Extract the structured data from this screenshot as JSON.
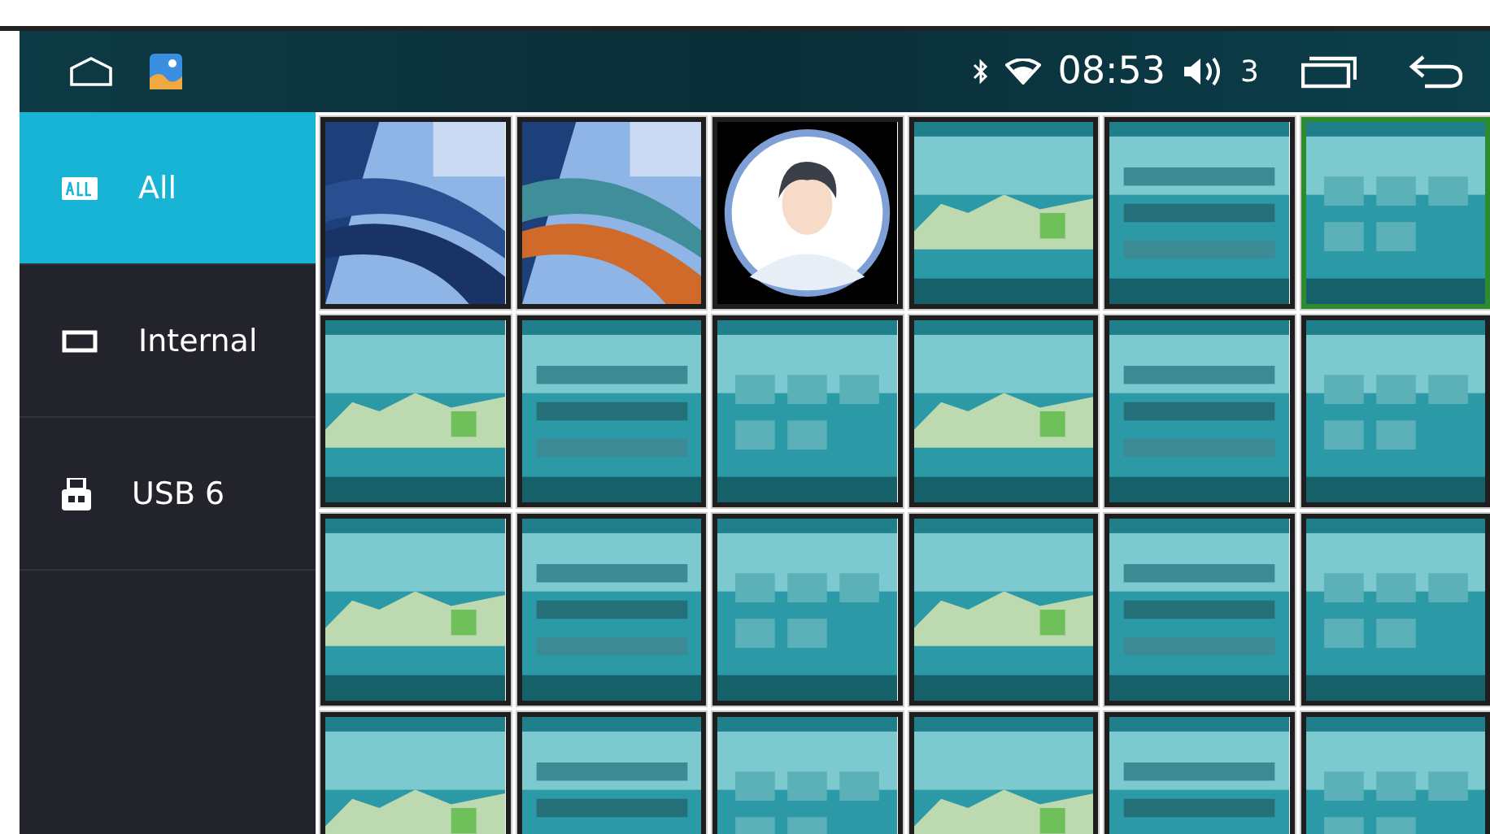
{
  "status_bar": {
    "time": "08:53",
    "volume": "3"
  },
  "sidebar": {
    "items": [
      {
        "label": "All",
        "kind": "all",
        "selected": true
      },
      {
        "label": "Internal",
        "kind": "internal",
        "selected": false
      },
      {
        "label": "USB 6",
        "kind": "usb",
        "selected": false
      }
    ]
  },
  "thumbnails": [
    {
      "kind": "picture",
      "selected": false
    },
    {
      "kind": "picture",
      "selected": false
    },
    {
      "kind": "picture",
      "selected": false
    },
    {
      "kind": "picture",
      "selected": false
    },
    {
      "kind": "picture",
      "selected": false
    },
    {
      "kind": "picture",
      "selected": true
    },
    {
      "kind": "picture",
      "selected": false
    },
    {
      "kind": "picture",
      "selected": false
    },
    {
      "kind": "picture",
      "selected": false
    },
    {
      "kind": "picture",
      "selected": false
    },
    {
      "kind": "picture",
      "selected": false
    },
    {
      "kind": "picture",
      "selected": false
    },
    {
      "kind": "picture",
      "selected": false
    },
    {
      "kind": "picture",
      "selected": false
    },
    {
      "kind": "picture",
      "selected": false
    },
    {
      "kind": "picture",
      "selected": false
    },
    {
      "kind": "picture",
      "selected": false
    },
    {
      "kind": "picture",
      "selected": false
    },
    {
      "kind": "picture",
      "selected": false
    },
    {
      "kind": "picture",
      "selected": false
    },
    {
      "kind": "picture",
      "selected": false
    },
    {
      "kind": "picture",
      "selected": false
    },
    {
      "kind": "picture",
      "selected": false
    },
    {
      "kind": "picture",
      "selected": false
    }
  ]
}
